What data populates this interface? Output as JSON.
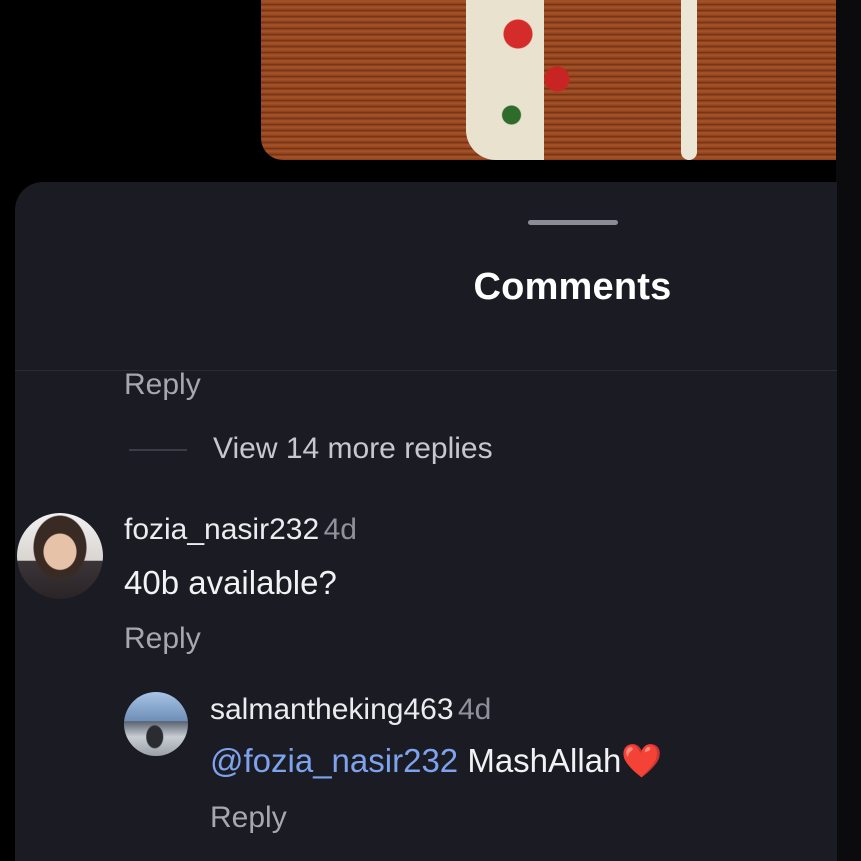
{
  "sheet": {
    "title": "Comments"
  },
  "thread": {
    "reply_label_top": "Reply",
    "view_more": "View 14 more replies"
  },
  "comments": [
    {
      "username": "fozia_nasir232",
      "age": "4d",
      "text": "40b available?",
      "reply_label": "Reply"
    }
  ],
  "replies": [
    {
      "username": "salmantheking463",
      "age": "4d",
      "mention": "@fozia_nasir232",
      "text": "MashAllah",
      "emoji": "❤️",
      "reply_label": "Reply"
    }
  ],
  "colors": {
    "sheet_bg": "#1b1b23",
    "mention": "#7ea3ee",
    "heart": "#e0201f"
  }
}
